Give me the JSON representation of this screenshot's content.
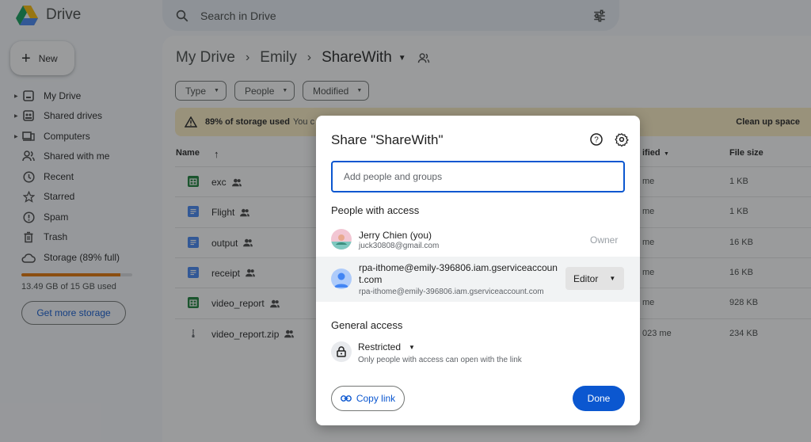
{
  "app": {
    "title": "Drive"
  },
  "search": {
    "placeholder": "Search in Drive"
  },
  "sidebar": {
    "new_label": "New",
    "items": [
      {
        "label": "My Drive",
        "icon": "my-drive-icon"
      },
      {
        "label": "Shared drives",
        "icon": "shared-drives-icon"
      },
      {
        "label": "Computers",
        "icon": "computers-icon"
      },
      {
        "label": "Shared with me",
        "icon": "shared-with-me-icon"
      },
      {
        "label": "Recent",
        "icon": "clock-icon"
      },
      {
        "label": "Starred",
        "icon": "star-icon"
      },
      {
        "label": "Spam",
        "icon": "spam-icon"
      },
      {
        "label": "Trash",
        "icon": "trash-icon"
      },
      {
        "label": "Storage (89% full)",
        "icon": "cloud-icon"
      }
    ],
    "storage_used_fraction": 0.89,
    "storage_text": "13.49 GB of 15 GB used",
    "get_storage_label": "Get more storage"
  },
  "breadcrumb": {
    "root": "My Drive",
    "parent": "Emily",
    "current": "ShareWith"
  },
  "filters": {
    "type": "Type",
    "people": "People",
    "modified": "Modified"
  },
  "banner": {
    "bold": "89% of storage used",
    "rest": "You c",
    "action": "Clean up space"
  },
  "table": {
    "col_name": "Name",
    "col_modified": "ified",
    "col_size": "File size",
    "rows": [
      {
        "name": "exc",
        "type": "sheet",
        "modified": "me",
        "size": "1 KB"
      },
      {
        "name": "Flight",
        "type": "doc",
        "modified": "me",
        "size": "1 KB"
      },
      {
        "name": "output",
        "type": "doc",
        "modified": "me",
        "size": "16 KB"
      },
      {
        "name": "receipt",
        "type": "doc",
        "modified": "me",
        "size": "16 KB"
      },
      {
        "name": "video_report",
        "type": "sheet",
        "modified": "me",
        "size": "928 KB"
      },
      {
        "name": "video_report.zip",
        "type": "zip",
        "modified": "023 me",
        "size": "234 KB"
      }
    ]
  },
  "dialog": {
    "title": "Share \"ShareWith\"",
    "input_placeholder": "Add people and groups",
    "people_heading": "People with access",
    "owner": {
      "name": "Jerry Chien (you)",
      "email": "juck30808@gmail.com",
      "role": "Owner"
    },
    "service_account": {
      "name_line1": "rpa-ithome@emily-396806.iam.gserviceaccoun",
      "name_line2": "t.com",
      "email": "rpa-ithome@emily-396806.iam.gserviceaccount.com",
      "role": "Editor"
    },
    "general_heading": "General access",
    "access_level": "Restricted",
    "access_desc": "Only people with access can open with the link",
    "copy_link": "Copy link",
    "done": "Done"
  },
  "colors": {
    "accent": "#0b57d0",
    "banner_bg": "#fdefc3",
    "storage_fill": "#e37400",
    "sheet_green": "#188038",
    "doc_blue": "#4285f4"
  }
}
